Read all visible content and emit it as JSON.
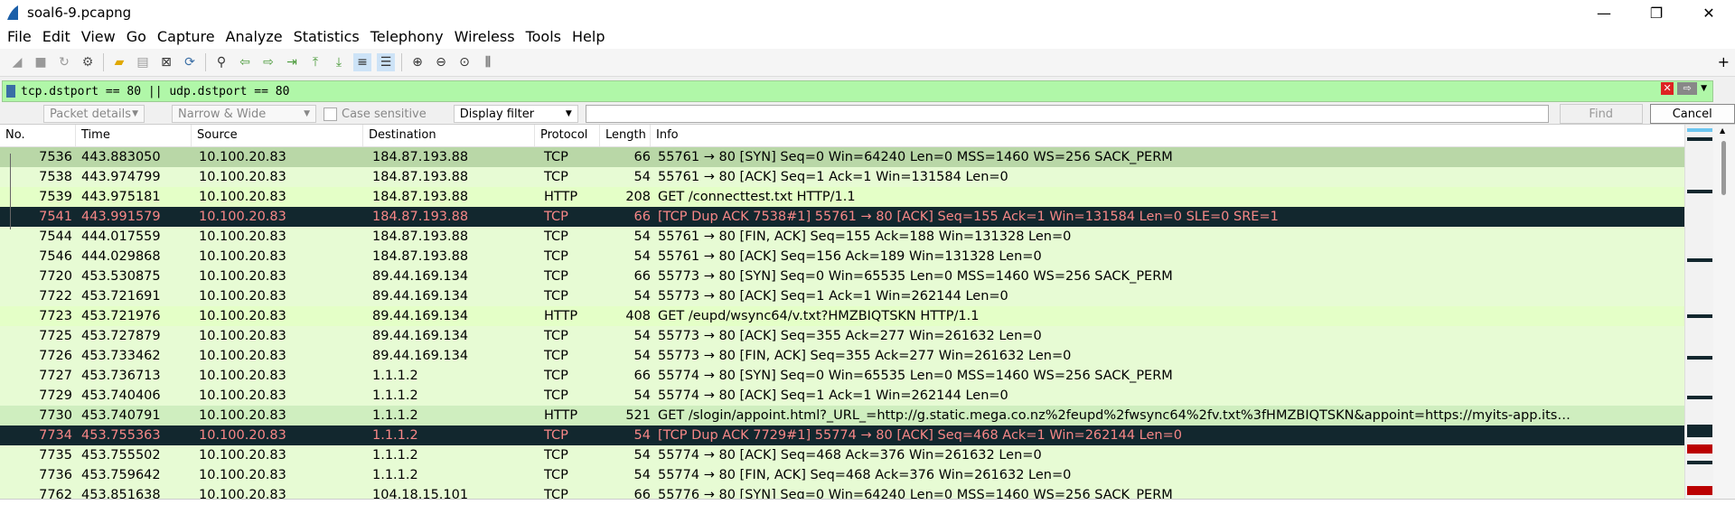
{
  "window": {
    "title": "soal6-9.pcapng",
    "controls": [
      "—",
      "❐",
      "✕"
    ]
  },
  "menu": [
    "File",
    "Edit",
    "View",
    "Go",
    "Capture",
    "Analyze",
    "Statistics",
    "Telephony",
    "Wireless",
    "Tools",
    "Help"
  ],
  "filter": {
    "value": "tcp.dstport == 80 || udp.dstport == 80",
    "plus": "+"
  },
  "findbar": {
    "packet_details": "Packet details",
    "narrow_wide": "Narrow & Wide",
    "case_sensitive": "Case sensitive",
    "display_filter": "Display filter",
    "find": "Find",
    "cancel": "Cancel"
  },
  "columns": [
    "No.",
    "Time",
    "Source",
    "Destination",
    "Protocol",
    "Length",
    "Info"
  ],
  "packets": [
    {
      "no": "7536",
      "time": "443.883050",
      "src": "10.100.20.83",
      "dst": "184.87.193.88",
      "proto": "TCP",
      "len": "66",
      "info": "55761 → 80 [SYN] Seq=0 Win=64240 Len=0 MSS=1460 WS=256 SACK_PERM",
      "style": "selected"
    },
    {
      "no": "7538",
      "time": "443.974799",
      "src": "10.100.20.83",
      "dst": "184.87.193.88",
      "proto": "TCP",
      "len": "54",
      "info": "55761 → 80 [ACK] Seq=1 Ack=1 Win=131584 Len=0",
      "style": "tcp"
    },
    {
      "no": "7539",
      "time": "443.975181",
      "src": "10.100.20.83",
      "dst": "184.87.193.88",
      "proto": "HTTP",
      "len": "208",
      "info": "GET /connecttest.txt HTTP/1.1",
      "style": "http"
    },
    {
      "no": "7541",
      "time": "443.991579",
      "src": "10.100.20.83",
      "dst": "184.87.193.88",
      "proto": "TCP",
      "len": "66",
      "info": "[TCP Dup ACK 7538#1] 55761 → 80 [ACK] Seq=155 Ack=1 Win=131584 Len=0 SLE=0 SRE=1",
      "style": "bad"
    },
    {
      "no": "7544",
      "time": "444.017559",
      "src": "10.100.20.83",
      "dst": "184.87.193.88",
      "proto": "TCP",
      "len": "54",
      "info": "55761 → 80 [FIN, ACK] Seq=155 Ack=188 Win=131328 Len=0",
      "style": "tcp"
    },
    {
      "no": "7546",
      "time": "444.029868",
      "src": "10.100.20.83",
      "dst": "184.87.193.88",
      "proto": "TCP",
      "len": "54",
      "info": "55761 → 80 [ACK] Seq=156 Ack=189 Win=131328 Len=0",
      "style": "tcp"
    },
    {
      "no": "7720",
      "time": "453.530875",
      "src": "10.100.20.83",
      "dst": "89.44.169.134",
      "proto": "TCP",
      "len": "66",
      "info": "55773 → 80 [SYN] Seq=0 Win=65535 Len=0 MSS=1460 WS=256 SACK_PERM",
      "style": "tcp"
    },
    {
      "no": "7722",
      "time": "453.721691",
      "src": "10.100.20.83",
      "dst": "89.44.169.134",
      "proto": "TCP",
      "len": "54",
      "info": "55773 → 80 [ACK] Seq=1 Ack=1 Win=262144 Len=0",
      "style": "tcp"
    },
    {
      "no": "7723",
      "time": "453.721976",
      "src": "10.100.20.83",
      "dst": "89.44.169.134",
      "proto": "HTTP",
      "len": "408",
      "info": "GET /eupd/wsync64/v.txt?HMZBIQTSKN HTTP/1.1",
      "style": "http"
    },
    {
      "no": "7725",
      "time": "453.727879",
      "src": "10.100.20.83",
      "dst": "89.44.169.134",
      "proto": "TCP",
      "len": "54",
      "info": "55773 → 80 [ACK] Seq=355 Ack=277 Win=261632 Len=0",
      "style": "tcp"
    },
    {
      "no": "7726",
      "time": "453.733462",
      "src": "10.100.20.83",
      "dst": "89.44.169.134",
      "proto": "TCP",
      "len": "54",
      "info": "55773 → 80 [FIN, ACK] Seq=355 Ack=277 Win=261632 Len=0",
      "style": "tcp"
    },
    {
      "no": "7727",
      "time": "453.736713",
      "src": "10.100.20.83",
      "dst": "1.1.1.2",
      "proto": "TCP",
      "len": "66",
      "info": "55774 → 80 [SYN] Seq=0 Win=65535 Len=0 MSS=1460 WS=256 SACK_PERM",
      "style": "tcp"
    },
    {
      "no": "7729",
      "time": "453.740406",
      "src": "10.100.20.83",
      "dst": "1.1.1.2",
      "proto": "TCP",
      "len": "54",
      "info": "55774 → 80 [ACK] Seq=1 Ack=1 Win=262144 Len=0",
      "style": "tcp"
    },
    {
      "no": "7730",
      "time": "453.740791",
      "src": "10.100.20.83",
      "dst": "1.1.1.2",
      "proto": "HTTP",
      "len": "521",
      "info": "GET /slogin/appoint.html?_URL_=http://g.static.mega.co.nz%2feupd%2fwsync64%2fv.txt%3fHMZBIQTSKN&appoint=https://myits-app.its…",
      "style": "http-sel"
    },
    {
      "no": "7734",
      "time": "453.755363",
      "src": "10.100.20.83",
      "dst": "1.1.1.2",
      "proto": "TCP",
      "len": "54",
      "info": "[TCP Dup ACK 7729#1] 55774 → 80 [ACK] Seq=468 Ack=1 Win=262144 Len=0",
      "style": "bad"
    },
    {
      "no": "7735",
      "time": "453.755502",
      "src": "10.100.20.83",
      "dst": "1.1.1.2",
      "proto": "TCP",
      "len": "54",
      "info": "55774 → 80 [ACK] Seq=468 Ack=376 Win=261632 Len=0",
      "style": "tcp"
    },
    {
      "no": "7736",
      "time": "453.759642",
      "src": "10.100.20.83",
      "dst": "1.1.1.2",
      "proto": "TCP",
      "len": "54",
      "info": "55774 → 80 [FIN, ACK] Seq=468 Ack=376 Win=261632 Len=0",
      "style": "tcp"
    },
    {
      "no": "7762",
      "time": "453.851638",
      "src": "10.100.20.83",
      "dst": "104.18.15.101",
      "proto": "TCP",
      "len": "66",
      "info": "55776 → 80 [SYN] Seq=0 Win=64240 Len=0 MSS=1460 WS=256 SACK_PERM",
      "style": "tcp"
    }
  ],
  "colors": {
    "tcp_row": "#e7fbd4",
    "http_row": "#e4ffc7",
    "bad_row_bg": "#12272e",
    "bad_row_fg": "#f78787",
    "filter_bg": "#b0f7a8"
  }
}
